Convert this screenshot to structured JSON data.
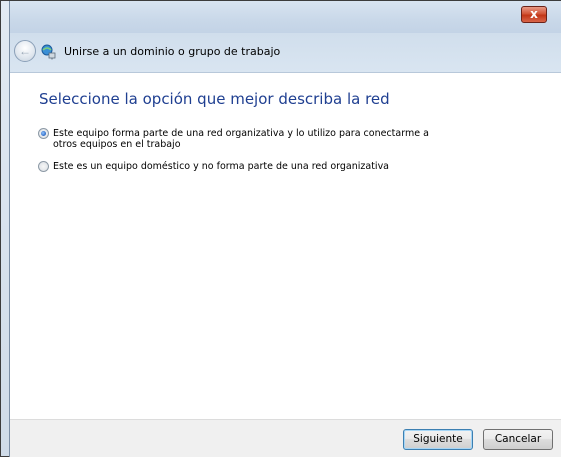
{
  "titlebar": {
    "close_label": "x"
  },
  "header": {
    "title": "Unirse a un dominio o grupo de trabajo",
    "back_icon": "back-arrow-icon",
    "wizard_icon": "network-join-icon"
  },
  "main": {
    "heading": "Seleccione la opción que mejor describa la red",
    "options": [
      {
        "label": "Este equipo forma parte de una red organizativa y lo utilizo para conectarme a otros equipos en el trabajo",
        "checked": true
      },
      {
        "label": "Este es un equipo doméstico y no forma parte de una red organizativa",
        "checked": false
      }
    ]
  },
  "footer": {
    "next_label": "Siguiente",
    "cancel_label": "Cancelar"
  }
}
